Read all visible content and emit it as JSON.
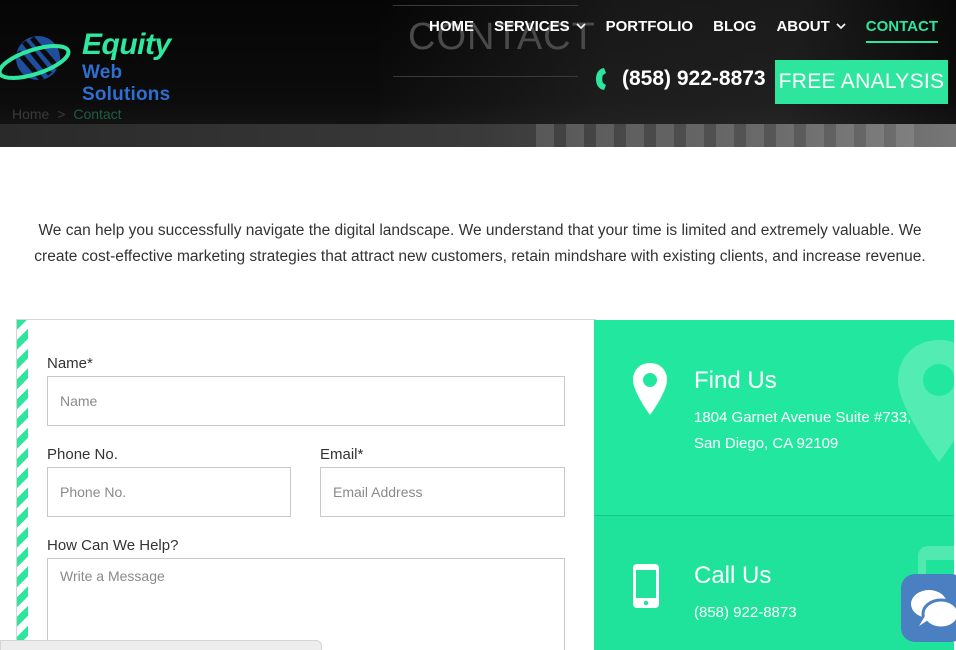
{
  "brand": {
    "line1": "Equity",
    "line2": "Web Solutions",
    "accent": "#2ee59d",
    "blue": "#2d6fd0"
  },
  "header": {
    "page_heading": "CONTACT",
    "breadcrumb": {
      "home": "Home",
      "separator": ">",
      "current": "Contact"
    },
    "nav": [
      {
        "label": "HOME",
        "dropdown": false,
        "active": false
      },
      {
        "label": "SERVICES",
        "dropdown": true,
        "active": false
      },
      {
        "label": "PORTFOLIO",
        "dropdown": false,
        "active": false
      },
      {
        "label": "BLOG",
        "dropdown": false,
        "active": false
      },
      {
        "label": "ABOUT",
        "dropdown": true,
        "active": false
      },
      {
        "label": "CONTACT",
        "dropdown": false,
        "active": true
      }
    ],
    "phone": "(858) 922-8873",
    "cta": "FREE ANALYSIS"
  },
  "intro": {
    "line1": "We can help you successfully navigate the digital landscape. We understand that your time is limited and extremely valuable. We",
    "line2": "create cost-effective marketing strategies that attract new customers, retain mindshare with existing clients, and increase revenue."
  },
  "form": {
    "name_label": "Name*",
    "name_placeholder": "Name",
    "name_value": "",
    "phone_label": "Phone No.",
    "phone_placeholder": "Phone No.",
    "phone_value": "",
    "email_label": "Email*",
    "email_placeholder": "Email Address",
    "email_value": "",
    "message_label": "How Can We Help?",
    "message_placeholder": "Write a Message",
    "message_value": ""
  },
  "info": {
    "find_title": "Find Us",
    "address_line1": "1804 Garnet Avenue Suite #733,",
    "address_line2": "San Diego, CA 92109",
    "call_title": "Call Us",
    "call_phone": "(858) 922-8873"
  },
  "icons": {
    "pin": "map-pin-icon",
    "mobile": "mobile-phone-icon",
    "chat": "chat-bubbles-icon",
    "phone": "phone-handset-icon"
  }
}
